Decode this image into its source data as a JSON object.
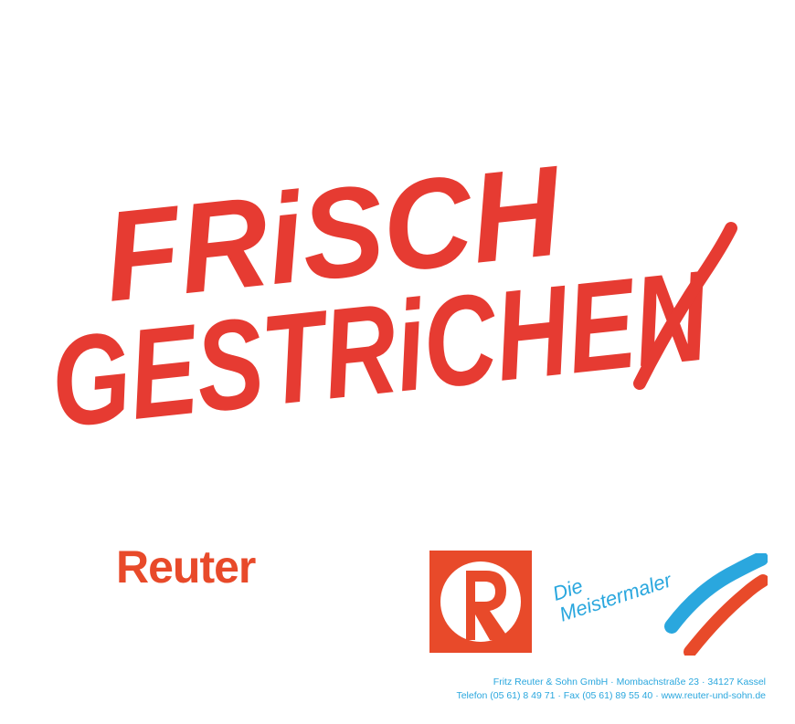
{
  "headline": {
    "line1": "FRiSCH",
    "line2": "GESTRiCHEN"
  },
  "brand": {
    "name": "Reuter",
    "tagline_line1": "Die",
    "tagline_line2": "Meistermaler"
  },
  "address": {
    "line1": "Fritz Reuter & Sohn GmbH · Mombachstraße 23 · 34127 Kassel",
    "line2": "Telefon (05 61) 8 49 71 · Fax (05 61) 89 55 40 · www.reuter-und-sohn.de"
  },
  "colors": {
    "headline_red": "#e63b32",
    "brand_red": "#e84a2a",
    "brand_blue": "#2aa7de",
    "background": "#ffffff"
  },
  "icons": {
    "logo": "reuter-r-logo-icon",
    "swoosh": "paint-swoosh-icon"
  }
}
